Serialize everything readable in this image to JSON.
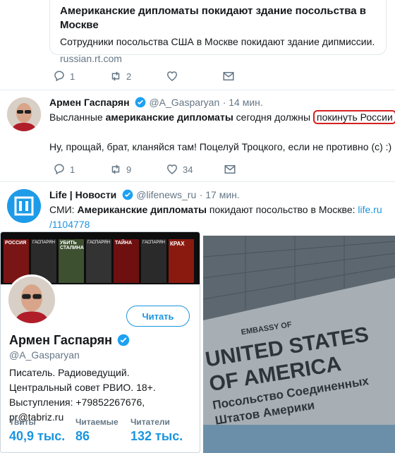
{
  "link_card": {
    "title": "Американские дипломаты покидают здание посольства в Москве",
    "description": "Сотрудники посольства США в Москве покидают здание дипмиссии.",
    "domain": "russian.rt.com"
  },
  "tweet1_actions": {
    "reply": "1",
    "retweet": "2",
    "like": ""
  },
  "tweet2": {
    "name": "Армен Гаспарян",
    "handle": "@A_Gasparyan",
    "time": "· 14 мин.",
    "text_a": "Высланные ",
    "text_b": "американские дипломаты",
    "text_c": " сегодня должны ",
    "text_highlight": "покинуть России",
    "text2": "Ну, прощай, брат, кланяйся там! Поцелуй Троцкого, если не противно (с) :)",
    "actions": {
      "reply": "1",
      "retweet": "9",
      "like": "34"
    }
  },
  "tweet3": {
    "name": "Life | Новости",
    "handle": "@lifenews_ru",
    "time": "· 17 мин.",
    "text_a": "СМИ: ",
    "text_b": "Американские дипломаты",
    "text_c": " покидают посольство в Москве: ",
    "link1": "life.ru",
    "link2": "/1104778"
  },
  "profile": {
    "banner_books": [
      "РОССИЯ",
      "ГАСПАРЯН",
      "УБИТЬ СТАЛИНА",
      "ГАСПАРЯН",
      "ТАЙНА",
      "ГАСПАРЯН",
      "КРАХ"
    ],
    "follow_label": "Читать",
    "name": "Армен Гаспарян",
    "handle": "@A_Gasparyan",
    "bio": "Писатель. Радиоведущий. Центральный совет РВИО. 18+. Выступления: +79852267676, pr@tabriz.ru",
    "stats": [
      {
        "label": "Твиты",
        "value": "40,9 тыс."
      },
      {
        "label": "Читаемые",
        "value": "86"
      },
      {
        "label": "Читатели",
        "value": "132 тыс."
      }
    ]
  },
  "photo": {
    "sign_top": "EMBASSY OF",
    "sign_l1": "UNITED STATES",
    "sign_l2": "OF AMERICA",
    "sign_l3": "Посольство Соединенных",
    "sign_l4": "Штатов Америки"
  },
  "colors": {
    "accent": "#1b95e0",
    "highlight": "#d42020",
    "verified": "#1da1f2"
  }
}
